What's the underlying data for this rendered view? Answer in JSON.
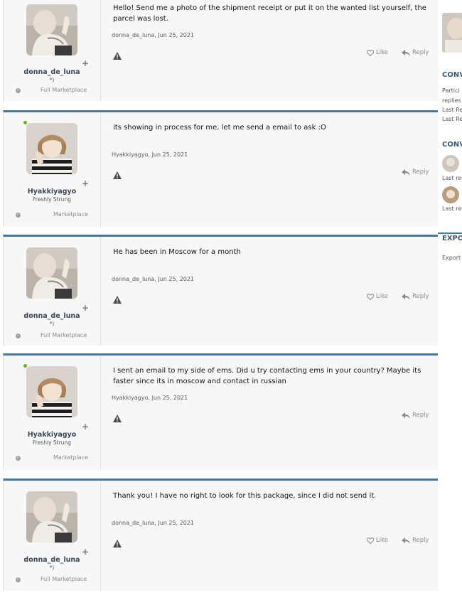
{
  "posts": [
    {
      "username": "donna_de_luna",
      "user_title": "*)",
      "badge": "Full Marketplace",
      "online": false,
      "message": "Hello! Send me a photo of the shipment receipt or put it on the wanted list yourself, the parcel was lost.",
      "meta": "donna_de_luna, Jun 25, 2021",
      "like_label": "Like",
      "reply_label": "Reply",
      "has_like": true
    },
    {
      "username": "Hyakkiyagyo",
      "user_title": "Freshly Strung",
      "badge": "Marketplace",
      "online": true,
      "message": "its showing in process for me, let me send a email to ask :O",
      "meta": "Hyakkiyagyo, Jun 25, 2021",
      "like_label": "",
      "reply_label": "Reply",
      "has_like": false
    },
    {
      "username": "donna_de_luna",
      "user_title": "*)",
      "badge": "Full Marketplace",
      "online": false,
      "message": "He has been in Moscow for a month",
      "meta": "donna_de_luna, Jun 25, 2021",
      "like_label": "Like",
      "reply_label": "Reply",
      "has_like": true
    },
    {
      "username": "Hyakkiyagyo",
      "user_title": "Freshly Strung",
      "badge": "Marketplace",
      "online": true,
      "message": "I sent an email to my side of ems. Did u try contacting ems in your country? Maybe its faster since its in moscow and contact in russian",
      "meta": "Hyakkiyagyo, Jun 25, 2021",
      "like_label": "",
      "reply_label": "Reply",
      "has_like": false
    },
    {
      "username": "donna_de_luna",
      "user_title": "*)",
      "badge": "Full Marketplace",
      "online": false,
      "message": "Thank you! I have no right to look for this package, since I did not send it.",
      "meta": "donna_de_luna, Jun 25, 2021",
      "like_label": "Like",
      "reply_label": "Reply",
      "has_like": true
    }
  ],
  "sidebar": {
    "section1_title": "CONV",
    "section1_lines": [
      "Partici",
      "replies",
      "Last Re",
      "Last Re"
    ],
    "section2_title": "CONV",
    "section2_lines": [
      "Last re",
      "Last re"
    ],
    "section3_title": "EXPO",
    "section3_lines": [
      "Export"
    ]
  },
  "icons": {
    "report": "warning-triangle-icon",
    "like": "heart-icon",
    "reply": "reply-arrow-icon",
    "badge": "check-circle-icon",
    "plus": "plus-icon"
  },
  "colors": {
    "accent": "#46779f",
    "online": "#63b516",
    "muted": "#8a8a8a"
  }
}
